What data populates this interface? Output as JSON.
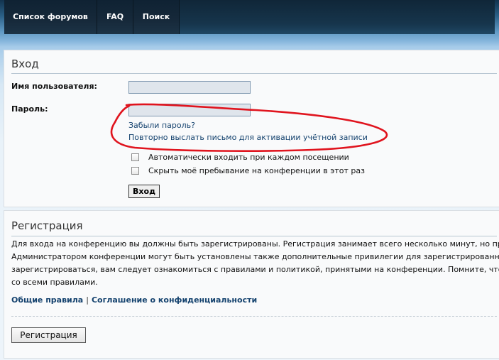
{
  "nav": {
    "forums": "Список форумов",
    "faq": "FAQ",
    "search": "Поиск"
  },
  "login": {
    "title": "Вход",
    "username_label": "Имя пользователя:",
    "username_value": "",
    "password_label": "Пароль:",
    "password_value": "",
    "forgot_password": "Забыли пароль?",
    "resend_activation": "Повторно выслать письмо для активации учётной записи",
    "auto_login": "Автоматически входить при каждом посещении",
    "auto_login_checked": false,
    "hide_online": "Скрыть моё пребывание на конференции в этот раз",
    "hide_online_checked": false,
    "submit": "Вход"
  },
  "register": {
    "title": "Регистрация",
    "text_lines": [
      "Для входа на конференцию вы должны быть зарегистрированы. Регистрация занимает всего несколько минут, но предо",
      "Администратором конференции могут быть установлены также дополнительные привилегии для зарегистрированных п",
      "зарегистрироваться, вам следует ознакомиться с правилами и политикой, принятыми на конференции. Помните, что ва",
      "со всеми правилами."
    ],
    "terms_link": "Общие правила",
    "separator": "|",
    "privacy_link": "Соглашение о конфиденциальности",
    "button": "Регистрация"
  },
  "colors": {
    "nav_bg": "#16293a",
    "link": "#14426e",
    "annotation": "#e0141e"
  }
}
